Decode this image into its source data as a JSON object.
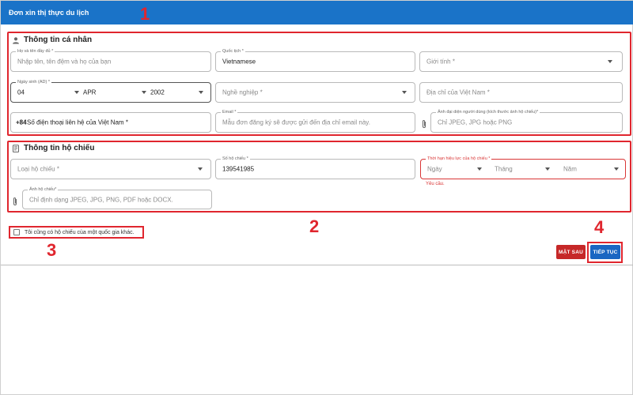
{
  "header": {
    "title": "Đơn xin thị thực du lịch"
  },
  "markers": [
    "1",
    "2",
    "3",
    "4"
  ],
  "personal": {
    "title": "Thông tin cá nhân",
    "full_name": {
      "label": "Họ và tên đầy đủ *",
      "placeholder": "Nhập tên, tên đệm và họ của bạn"
    },
    "nationality": {
      "label": "Quốc tịch *",
      "value": "Vietnamese"
    },
    "gender": {
      "placeholder": "Giới tính *"
    },
    "dob": {
      "label": "Ngày sinh (AD) *",
      "day": "04",
      "month": "APR",
      "year": "2002"
    },
    "occupation": {
      "placeholder": "Nghề nghiệp *"
    },
    "address": {
      "placeholder": "Địa chỉ của Việt Nam *"
    },
    "phone": {
      "prefix": "+84",
      "placeholder": "Số điện thoại liên hệ của Việt Nam *"
    },
    "email": {
      "label": "Email *",
      "placeholder": "Mẫu đơn đăng ký sẽ được gửi đến địa chỉ email này."
    },
    "photo": {
      "label": "Ảnh đại diện người dùng (kích thước ảnh hộ chiếu)*",
      "placeholder": "Chỉ JPEG, JPG hoặc PNG"
    }
  },
  "passport": {
    "title": "Thông tin hộ chiếu",
    "type": {
      "placeholder": "Loại hộ chiếu *"
    },
    "number": {
      "label": "Số hộ chiếu *",
      "value": "139541985"
    },
    "expiry": {
      "label": "Thời hạn hiệu lực của hộ chiếu *",
      "day": "Ngày",
      "month": "Tháng",
      "year": "Năm",
      "error": "Yêu cầu."
    },
    "image": {
      "label": "Ảnh hộ chiếu*",
      "placeholder": "Chỉ định dạng JPEG, JPG, PNG, PDF hoặc DOCX."
    }
  },
  "other_passport": {
    "label": "Tôi cũng có hộ chiếu của một quốc gia khác."
  },
  "actions": {
    "later": "MẶT SAU",
    "next": "TIẾP TỤC"
  },
  "colors": {
    "header": "#1a73c8",
    "annotation": "#e0262e",
    "next_button": "#1a66c2",
    "later_button": "#c62828"
  },
  "icons": [
    "user-icon",
    "passport-icon",
    "paperclip-icon",
    "chevron-down-icon"
  ]
}
